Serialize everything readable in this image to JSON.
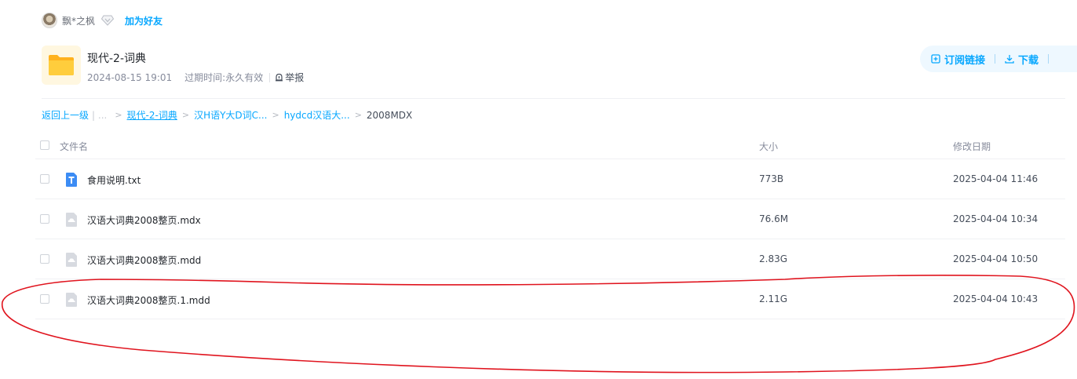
{
  "user": {
    "name": "飘*之枫",
    "add_friend": "加为好友"
  },
  "share": {
    "title": "现代-2-词典",
    "created": "2024-08-15 19:01",
    "expire_label": "过期时间:",
    "expire_value": "永久有效",
    "report": "举报"
  },
  "actions": {
    "subscribe": "订阅链接",
    "download": "下载"
  },
  "breadcrumb": {
    "back": "返回上一级",
    "sep_text": "| ...",
    "items": [
      "现代-2-词典",
      "汉H语Y大D词C...",
      "hydcd汉语大..."
    ],
    "current": "2008MDX"
  },
  "table": {
    "headers": {
      "name": "文件名",
      "size": "大小",
      "date": "修改日期"
    },
    "rows": [
      {
        "name": "食用说明.txt",
        "size": "773B",
        "date": "2025-04-04 11:46",
        "icon": "txt-file-icon"
      },
      {
        "name": "汉语大词典2008整页.mdx",
        "size": "76.6M",
        "date": "2025-04-04 10:34",
        "icon": "generic-file-icon"
      },
      {
        "name": "汉语大词典2008整页.mdd",
        "size": "2.83G",
        "date": "2025-04-04 10:50",
        "icon": "generic-file-icon"
      },
      {
        "name": "汉语大词典2008整页.1.mdd",
        "size": "2.11G",
        "date": "2025-04-04 10:43",
        "icon": "generic-file-icon"
      }
    ]
  },
  "colors": {
    "accent": "#06a7ff",
    "annotation": "#e0141e",
    "folder": "#ffc229"
  }
}
